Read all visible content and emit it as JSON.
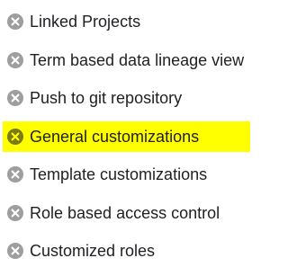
{
  "features": [
    {
      "label": "Linked Projects",
      "icon": "x-circle-icon",
      "highlighted": false
    },
    {
      "label": "Term based data lineage view",
      "icon": "x-circle-icon",
      "highlighted": false
    },
    {
      "label": "Push to git repository",
      "icon": "x-circle-icon",
      "highlighted": false
    },
    {
      "label": "General customizations",
      "icon": "x-circle-icon",
      "highlighted": true
    },
    {
      "label": "Template customizations",
      "icon": "x-circle-icon",
      "highlighted": false
    },
    {
      "label": "Role based access control",
      "icon": "x-circle-icon",
      "highlighted": false
    },
    {
      "label": "Customized roles",
      "icon": "x-circle-icon",
      "highlighted": false
    }
  ],
  "colors": {
    "icon_fill": "#9e9e9e",
    "icon_fill_highlighted": "#7a7a18",
    "highlight": "#ffff00",
    "text": "#202124"
  }
}
